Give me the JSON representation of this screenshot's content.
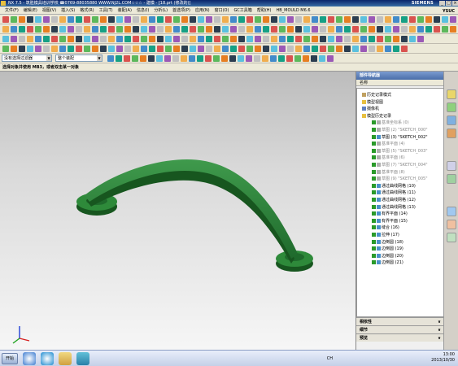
{
  "window": {
    "title": "NX 7.5 - 筑胜模具培训学校 ☎0769-88035880  WWW.NJ2L.COM☆☆☆ - 建模 - [18.prt (修改的)]",
    "brand": "SIEMENS"
  },
  "menu": {
    "items": [
      "文件(F)",
      "编辑(E)",
      "视图(V)",
      "插入(S)",
      "格式(R)",
      "工具(T)",
      "装配(A)",
      "信息(I)",
      "分析(L)",
      "首选项(P)",
      "应用(N)",
      "窗口(O)",
      "GC工具箱",
      "帮助(H)",
      "HB_MOULD M6.6"
    ],
    "right_label": "YSUC"
  },
  "selection_bar": {
    "filter": "没有选择过滤器",
    "scope": "整个装配"
  },
  "cue_line": "选择对象并使用 MB3，或者双击某一对象",
  "navigator": {
    "title": "部件导航器",
    "column_header": "名称",
    "nodes": [
      {
        "label": "历史记录模式",
        "level": 1,
        "grey": false,
        "icon": "history-icon"
      },
      {
        "label": "模型视图",
        "level": 1,
        "grey": false,
        "icon": "folder-icon"
      },
      {
        "label": "摄像机",
        "level": 1,
        "grey": false,
        "icon": "camera-icon"
      },
      {
        "label": "模型历史记录",
        "level": 1,
        "grey": false,
        "icon": "folder-icon"
      },
      {
        "label": "基准坐标系 (0)",
        "level": 2,
        "grey": true
      },
      {
        "label": "草图 (2) \"SKETCH_000\"",
        "level": 2,
        "grey": true
      },
      {
        "label": "草图 (3) \"SKETCH_002\"",
        "level": 2,
        "grey": false
      },
      {
        "label": "基准平面 (4)",
        "level": 2,
        "grey": true
      },
      {
        "label": "草图 (5) \"SKETCH_003\"",
        "level": 2,
        "grey": true
      },
      {
        "label": "基准平面 (6)",
        "level": 2,
        "grey": true
      },
      {
        "label": "草图 (7) \"SKETCH_004\"",
        "level": 2,
        "grey": true
      },
      {
        "label": "基准平面 (8)",
        "level": 2,
        "grey": true
      },
      {
        "label": "草图 (9) \"SKETCH_005\"",
        "level": 2,
        "grey": true
      },
      {
        "label": "通过曲线网格 (10)",
        "level": 2,
        "grey": false
      },
      {
        "label": "通过曲线网格 (11)",
        "level": 2,
        "grey": false
      },
      {
        "label": "通过曲线网格 (12)",
        "level": 2,
        "grey": false
      },
      {
        "label": "通过曲线网格 (13)",
        "level": 2,
        "grey": false
      },
      {
        "label": "有界平面 (14)",
        "level": 2,
        "grey": false
      },
      {
        "label": "有界平面 (15)",
        "level": 2,
        "grey": false
      },
      {
        "label": "缝合 (16)",
        "level": 2,
        "grey": false
      },
      {
        "label": "拉伸 (17)",
        "level": 2,
        "grey": false
      },
      {
        "label": "边倒圆 (18)",
        "level": 2,
        "grey": false
      },
      {
        "label": "边倒圆 (19)",
        "level": 2,
        "grey": false
      },
      {
        "label": "边倒圆 (20)",
        "level": 2,
        "grey": false
      },
      {
        "label": "边倒圆 (21)",
        "level": 2,
        "grey": false
      }
    ],
    "panels": [
      "相依性",
      "细节",
      "预览"
    ]
  },
  "taskbar": {
    "start_label": "开始",
    "time": "13:00",
    "date": "2013/10/30",
    "lang": "CH"
  },
  "colors": {
    "part": "#1f6a2c",
    "part_highlight": "#3f9a4c",
    "titlebar": "#0a246a"
  }
}
